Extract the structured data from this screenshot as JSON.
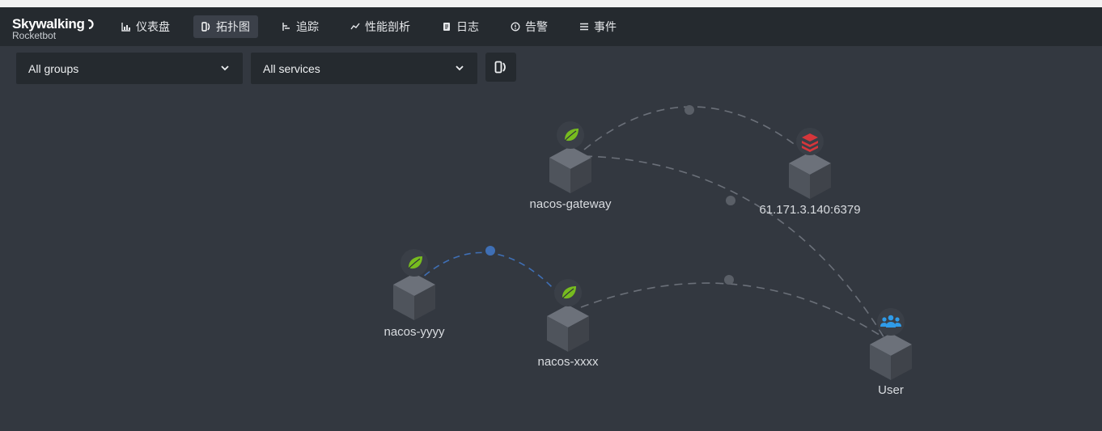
{
  "app": {
    "logo_main": "Skywalking",
    "logo_sub": "Rocketbot"
  },
  "nav": {
    "items": [
      {
        "label": "仪表盘",
        "icon": "chart-icon",
        "active": false
      },
      {
        "label": "拓扑图",
        "icon": "topology-icon",
        "active": true
      },
      {
        "label": "追踪",
        "icon": "trace-icon",
        "active": false
      },
      {
        "label": "性能剖析",
        "icon": "profile-icon",
        "active": false
      },
      {
        "label": "日志",
        "icon": "log-icon",
        "active": false
      },
      {
        "label": "告警",
        "icon": "alarm-icon",
        "active": false
      },
      {
        "label": "事件",
        "icon": "event-icon",
        "active": false
      }
    ]
  },
  "filters": {
    "group_select": "All groups",
    "service_select": "All services"
  },
  "topology": {
    "nodes": [
      {
        "id": "gateway",
        "label": "nacos-gateway",
        "type": "spring-icon"
      },
      {
        "id": "redis",
        "label": "61.171.3.140:6379",
        "type": "redis-icon"
      },
      {
        "id": "yyyy",
        "label": "nacos-yyyy",
        "type": "spring-icon"
      },
      {
        "id": "xxxx",
        "label": "nacos-xxxx",
        "type": "spring-icon"
      },
      {
        "id": "user",
        "label": "User",
        "type": "user-icon"
      }
    ],
    "links": [
      {
        "from": "gateway",
        "to": "redis"
      },
      {
        "from": "gateway",
        "to": "user"
      },
      {
        "from": "yyyy",
        "to": "xxxx"
      },
      {
        "from": "xxxx",
        "to": "user"
      }
    ]
  },
  "colors": {
    "background": "#333840",
    "navbar": "#252a2f",
    "link": "#6b7079",
    "active_link": "#3f6fb5",
    "spring": "#77bc1f",
    "redis": "#d6363b",
    "user": "#2f9be8"
  }
}
